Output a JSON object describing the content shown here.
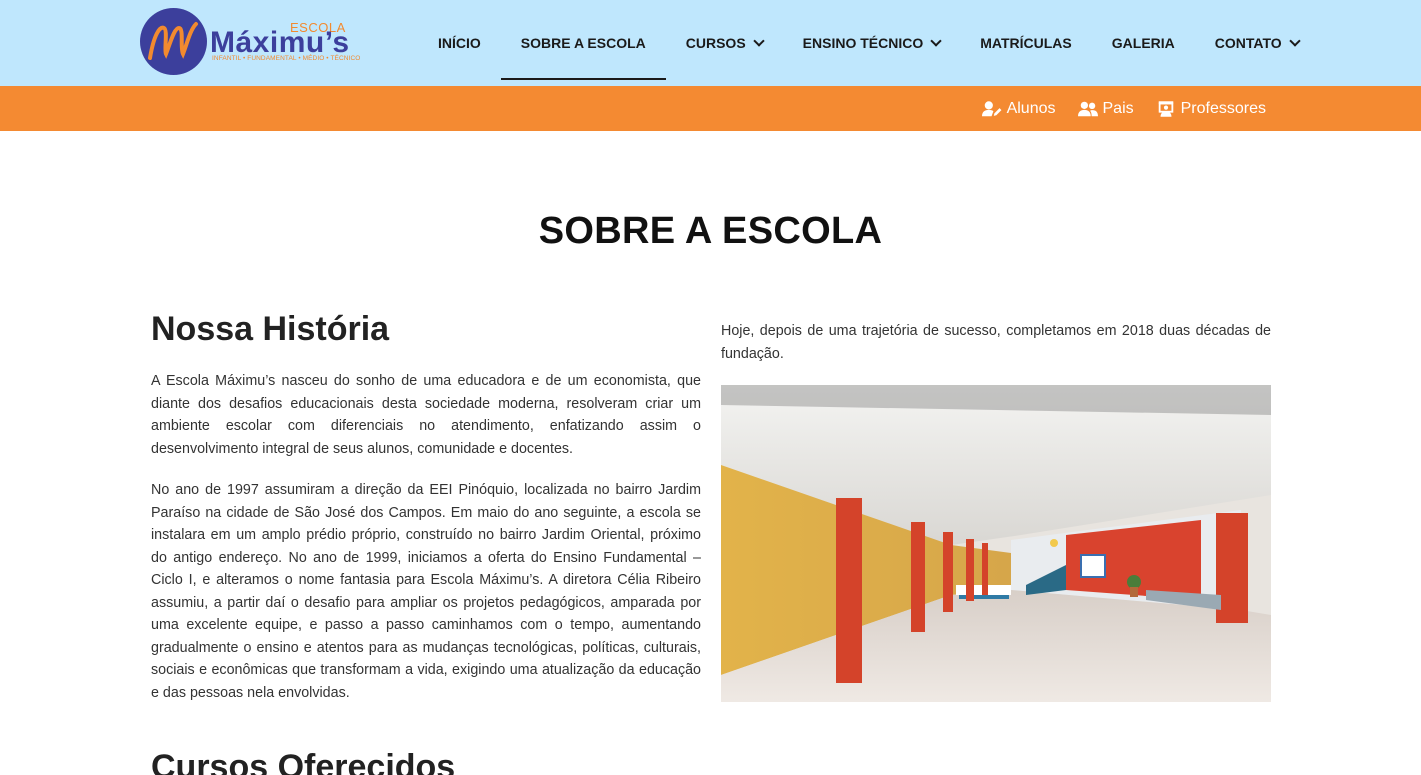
{
  "logo": {
    "escola": "ESCOLA",
    "name": "Máximu’s",
    "tagline": "INFANTIL • FUNDAMENTAL • MÉDIO • TÉCNICO"
  },
  "nav": {
    "items": [
      {
        "label": "INÍCIO",
        "dropdown": false,
        "active": false
      },
      {
        "label": "SOBRE A ESCOLA",
        "dropdown": false,
        "active": true
      },
      {
        "label": "CURSOS",
        "dropdown": true,
        "active": false
      },
      {
        "label": "ENSINO TÉCNICO",
        "dropdown": true,
        "active": false
      },
      {
        "label": "MATRÍCULAS",
        "dropdown": false,
        "active": false
      },
      {
        "label": "GALERIA",
        "dropdown": false,
        "active": false
      },
      {
        "label": "CONTATO",
        "dropdown": true,
        "active": false
      }
    ]
  },
  "quick_links": {
    "alunos": "Alunos",
    "pais": "Pais",
    "professores": "Professores"
  },
  "page": {
    "title": "SOBRE A ESCOLA"
  },
  "history": {
    "heading": "Nossa História",
    "p1": "A Escola Máximu’s nasceu do sonho de uma educadora e de um economista, que diante dos desafios educacionais desta sociedade moderna, resolveram criar um ambiente escolar com diferenciais no atendimento, enfatizando assim o desenvolvimento integral de seus alunos, comunidade e docentes.",
    "p2": "No ano de 1997 assumiram a direção da EEI Pinóquio, localizada no bairro Jardim Paraíso na cidade de São José dos Campos. Em maio do ano seguinte, a escola se instalara em um amplo prédio próprio, construído no bairro Jardim Oriental, próximo do antigo endereço. No ano de 1999, iniciamos a oferta do Ensino Fundamental – Ciclo I, e alteramos o nome fantasia para Escola Máximu’s. A diretora Célia Ribeiro assumiu, a partir daí o desafio para ampliar os projetos pedagógicos, amparada por uma excelente equipe, e passo a passo caminhamos com o tempo, aumentando gradualmente o ensino e atentos para as mudanças tecnológicas, políticas, culturais, sociais e econômicas que transformam a vida, exigindo uma atualização da educação e das pessoas nela envolvidas.",
    "p3": "Hoje, depois de uma trajetória de sucesso, completamos em 2018 duas décadas de fundação."
  },
  "courses": {
    "heading": "Cursos Oferecidos"
  },
  "colors": {
    "header_bg": "#bfe7fd",
    "orange_bar": "#f48a32",
    "brand_blue": "#3c3f9c",
    "brand_orange": "#f28a2f"
  }
}
